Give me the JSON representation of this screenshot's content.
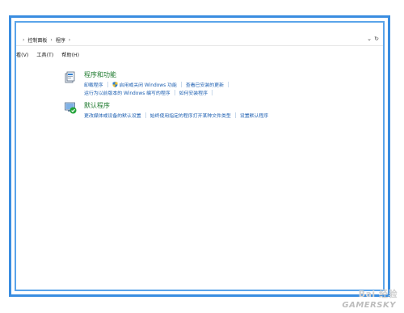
{
  "addressbar": {
    "crumbs": [
      "控制面板",
      "程序"
    ],
    "separator": "›",
    "dropdown_glyph": "⌄",
    "refresh_glyph": "↻"
  },
  "menubar": [
    "看(V)",
    "工具(T)",
    "帮助(H)"
  ],
  "programs_features": {
    "icon": "programs-icon",
    "title": "程序和功能",
    "row1": [
      "卸载程序",
      "启用或关闭 Windows 功能",
      "查看已安装的更新"
    ],
    "row2": [
      "运行为以前版本的 Windows 编写的程序",
      "如何安装程序"
    ]
  },
  "default_programs": {
    "icon": "default-programs-icon",
    "title": "默认程序",
    "row1": [
      "更改媒体或设备的默认设置",
      "始终使用指定的程序打开某种文件类型",
      "设置默认程序"
    ]
  },
  "watermark": {
    "baidu": "Bai 经验",
    "gamersky": "GAMERSKY"
  }
}
